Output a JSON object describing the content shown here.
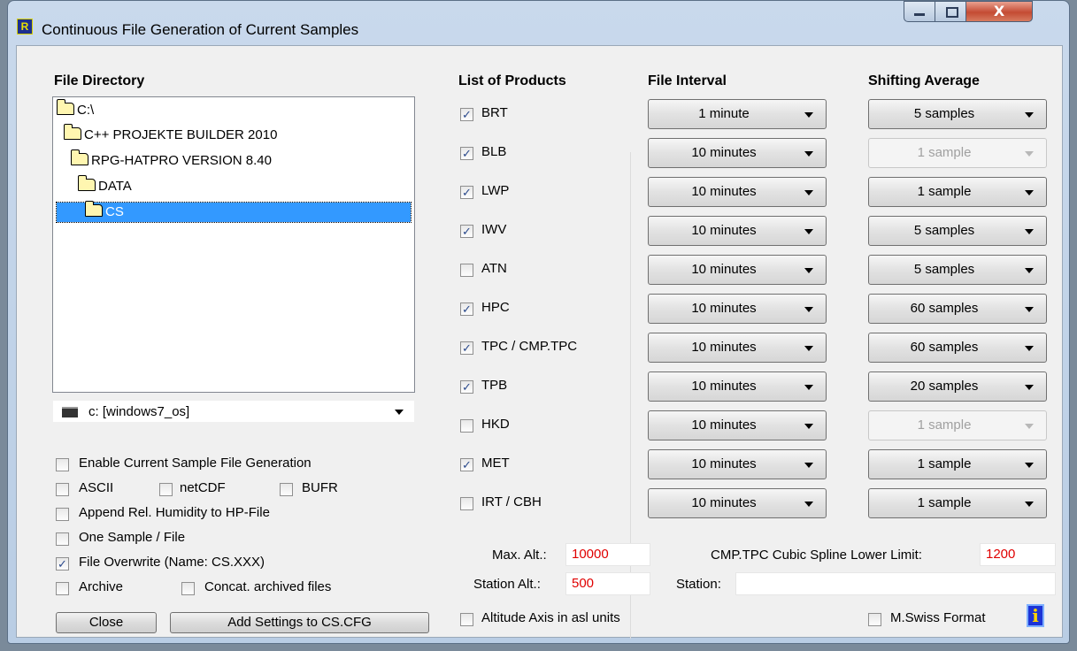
{
  "window": {
    "title": "Continuous File Generation of Current Samples",
    "app_icon": "R",
    "close_glyph": "X"
  },
  "headers": {
    "file_directory": "File Directory",
    "list_of_products": "List of Products",
    "file_interval": "File Interval",
    "shifting_average": "Shifting Average"
  },
  "tree": [
    {
      "label": "C:\\",
      "selected": false
    },
    {
      "label": "C++ PROJEKTE BUILDER 2010",
      "selected": false
    },
    {
      "label": "RPG-HATPRO VERSION 8.40",
      "selected": false
    },
    {
      "label": "DATA",
      "selected": false
    },
    {
      "label": "CS",
      "selected": true
    }
  ],
  "drive": "c: [windows7_os]",
  "options": [
    {
      "label": "Enable Current Sample File Generation",
      "checked": false
    },
    {
      "label": "ASCII",
      "checked": false
    },
    {
      "label": "netCDF",
      "checked": false
    },
    {
      "label": "BUFR",
      "checked": false
    },
    {
      "label": "Append Rel. Humidity to HP-File",
      "checked": false
    },
    {
      "label": "One Sample / File",
      "checked": false
    },
    {
      "label": "File Overwrite (Name: CS.XXX)",
      "checked": true
    },
    {
      "label": "Archive",
      "checked": false
    },
    {
      "label": "Concat. archived files",
      "checked": false
    }
  ],
  "buttons": {
    "close": "Close",
    "add_settings": "Add Settings to CS.CFG",
    "info": "i"
  },
  "products": [
    {
      "name": "BRT",
      "checked": true,
      "interval": "1 minute",
      "average": "5 samples",
      "average_enabled": true
    },
    {
      "name": "BLB",
      "checked": true,
      "interval": "10 minutes",
      "average": "1 sample",
      "average_enabled": false
    },
    {
      "name": "LWP",
      "checked": true,
      "interval": "10 minutes",
      "average": "1 sample",
      "average_enabled": true
    },
    {
      "name": "IWV",
      "checked": true,
      "interval": "10 minutes",
      "average": "5 samples",
      "average_enabled": true
    },
    {
      "name": "ATN",
      "checked": false,
      "interval": "10 minutes",
      "average": "5 samples",
      "average_enabled": true
    },
    {
      "name": "HPC",
      "checked": true,
      "interval": "10 minutes",
      "average": "60 samples",
      "average_enabled": true
    },
    {
      "name": "TPC / CMP.TPC",
      "checked": true,
      "interval": "10 minutes",
      "average": "60 samples",
      "average_enabled": true
    },
    {
      "name": "TPB",
      "checked": true,
      "interval": "10 minutes",
      "average": "20 samples",
      "average_enabled": true
    },
    {
      "name": "HKD",
      "checked": false,
      "interval": "10 minutes",
      "average": "1 sample",
      "average_enabled": false
    },
    {
      "name": "MET",
      "checked": true,
      "interval": "10 minutes",
      "average": "1 sample",
      "average_enabled": true
    },
    {
      "name": "IRT / CBH",
      "checked": false,
      "interval": "10 minutes",
      "average": "1 sample",
      "average_enabled": true
    }
  ],
  "fields": {
    "max_alt_label": "Max. Alt.:",
    "max_alt_value": "10000",
    "station_alt_label": "Station Alt.:",
    "station_alt_value": "500",
    "spline_label": "CMP.TPC Cubic Spline Lower Limit:",
    "spline_value": "1200",
    "station_label": "Station:",
    "station_value": ""
  },
  "bottom_checks": {
    "altitude_axis": {
      "label": "Altitude Axis in asl units",
      "checked": false
    },
    "swiss_format": {
      "label": "M.Swiss Format",
      "checked": false
    }
  }
}
